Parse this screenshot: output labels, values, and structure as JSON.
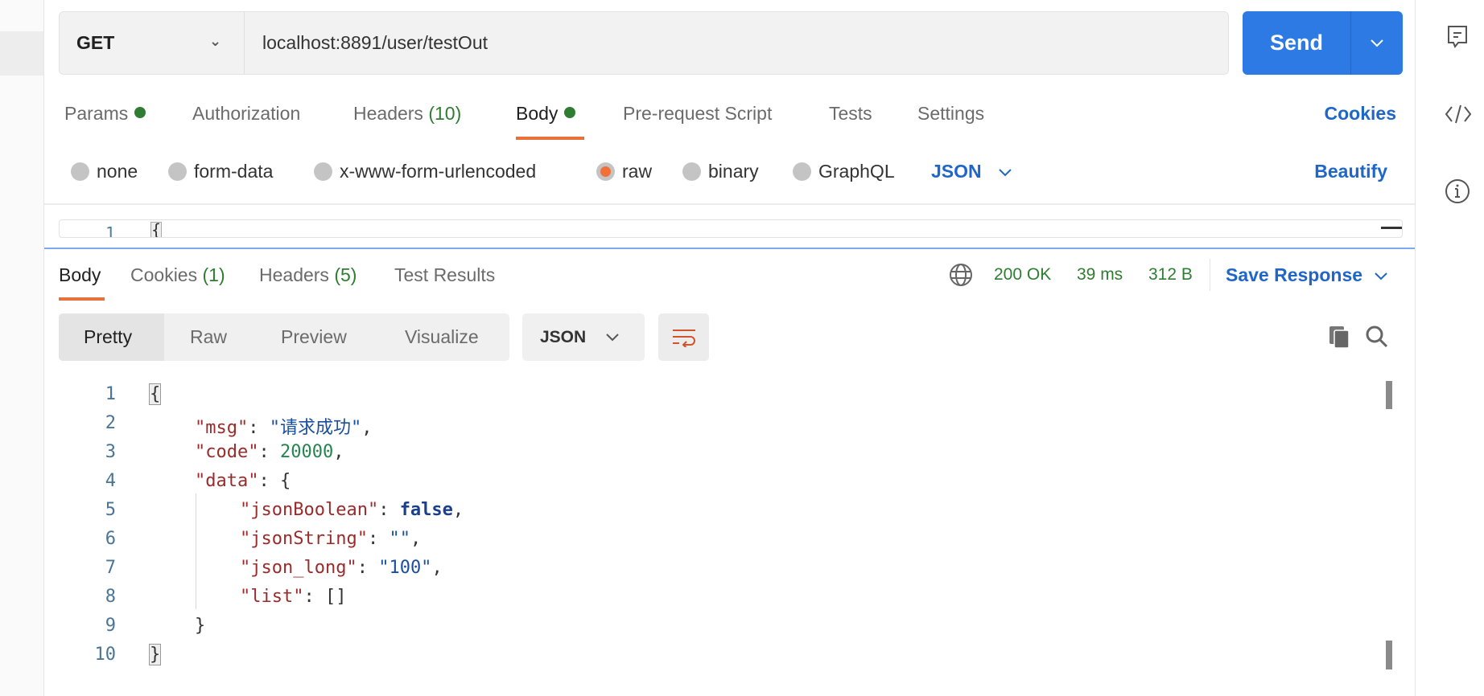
{
  "request": {
    "method": "GET",
    "url": "localhost:8891/user/testOut",
    "send_label": "Send"
  },
  "request_tabs": [
    {
      "label": "Params",
      "dot": true
    },
    {
      "label": "Authorization"
    },
    {
      "label": "Headers",
      "count": "(10)"
    },
    {
      "label": "Body",
      "dot": true,
      "active": true
    },
    {
      "label": "Pre-request Script"
    },
    {
      "label": "Tests"
    },
    {
      "label": "Settings"
    }
  ],
  "cookies_link": "Cookies",
  "body_types": [
    "none",
    "form-data",
    "x-www-form-urlencoded",
    "raw",
    "binary",
    "GraphQL"
  ],
  "body_type_selected": "raw",
  "body_format": "JSON",
  "beautify_label": "Beautify",
  "editor": {
    "line": "1",
    "text": "{"
  },
  "response_tabs": [
    {
      "label": "Body",
      "active": true
    },
    {
      "label": "Cookies",
      "count": "(1)"
    },
    {
      "label": "Headers",
      "count": "(5)"
    },
    {
      "label": "Test Results"
    }
  ],
  "status": {
    "code": "200 OK",
    "time": "39 ms",
    "size": "312 B",
    "color": "#2e7d32"
  },
  "save_response": "Save Response",
  "view_modes": [
    "Pretty",
    "Raw",
    "Preview",
    "Visualize"
  ],
  "view_mode_selected": "Pretty",
  "response_format": "JSON",
  "response_lines": [
    {
      "n": "1",
      "indent": 0,
      "parts": [
        [
          "p",
          "{"
        ]
      ]
    },
    {
      "n": "2",
      "indent": 1,
      "parts": [
        [
          "k",
          "\"msg\""
        ],
        [
          "p",
          ": "
        ],
        [
          "s",
          "\"请求成功\""
        ],
        [
          "p",
          ","
        ]
      ]
    },
    {
      "n": "3",
      "indent": 1,
      "parts": [
        [
          "k",
          "\"code\""
        ],
        [
          "p",
          ": "
        ],
        [
          "n",
          "20000"
        ],
        [
          "p",
          ","
        ]
      ]
    },
    {
      "n": "4",
      "indent": 1,
      "parts": [
        [
          "k",
          "\"data\""
        ],
        [
          "p",
          ": {"
        ]
      ]
    },
    {
      "n": "5",
      "indent": 2,
      "parts": [
        [
          "k",
          "\"jsonBoolean\""
        ],
        [
          "p",
          ": "
        ],
        [
          "b",
          "false"
        ],
        [
          "p",
          ","
        ]
      ]
    },
    {
      "n": "6",
      "indent": 2,
      "parts": [
        [
          "k",
          "\"jsonString\""
        ],
        [
          "p",
          ": "
        ],
        [
          "s",
          "\"\""
        ],
        [
          "p",
          ","
        ]
      ]
    },
    {
      "n": "7",
      "indent": 2,
      "parts": [
        [
          "k",
          "\"json_long\""
        ],
        [
          "p",
          ": "
        ],
        [
          "s",
          "\"100\""
        ],
        [
          "p",
          ","
        ]
      ]
    },
    {
      "n": "8",
      "indent": 2,
      "parts": [
        [
          "k",
          "\"list\""
        ],
        [
          "p",
          ": []"
        ]
      ]
    },
    {
      "n": "9",
      "indent": 1,
      "parts": [
        [
          "p",
          "}"
        ]
      ]
    },
    {
      "n": "10",
      "indent": 0,
      "parts": [
        [
          "p",
          "}"
        ]
      ]
    }
  ],
  "accent": "#2d7ae5"
}
